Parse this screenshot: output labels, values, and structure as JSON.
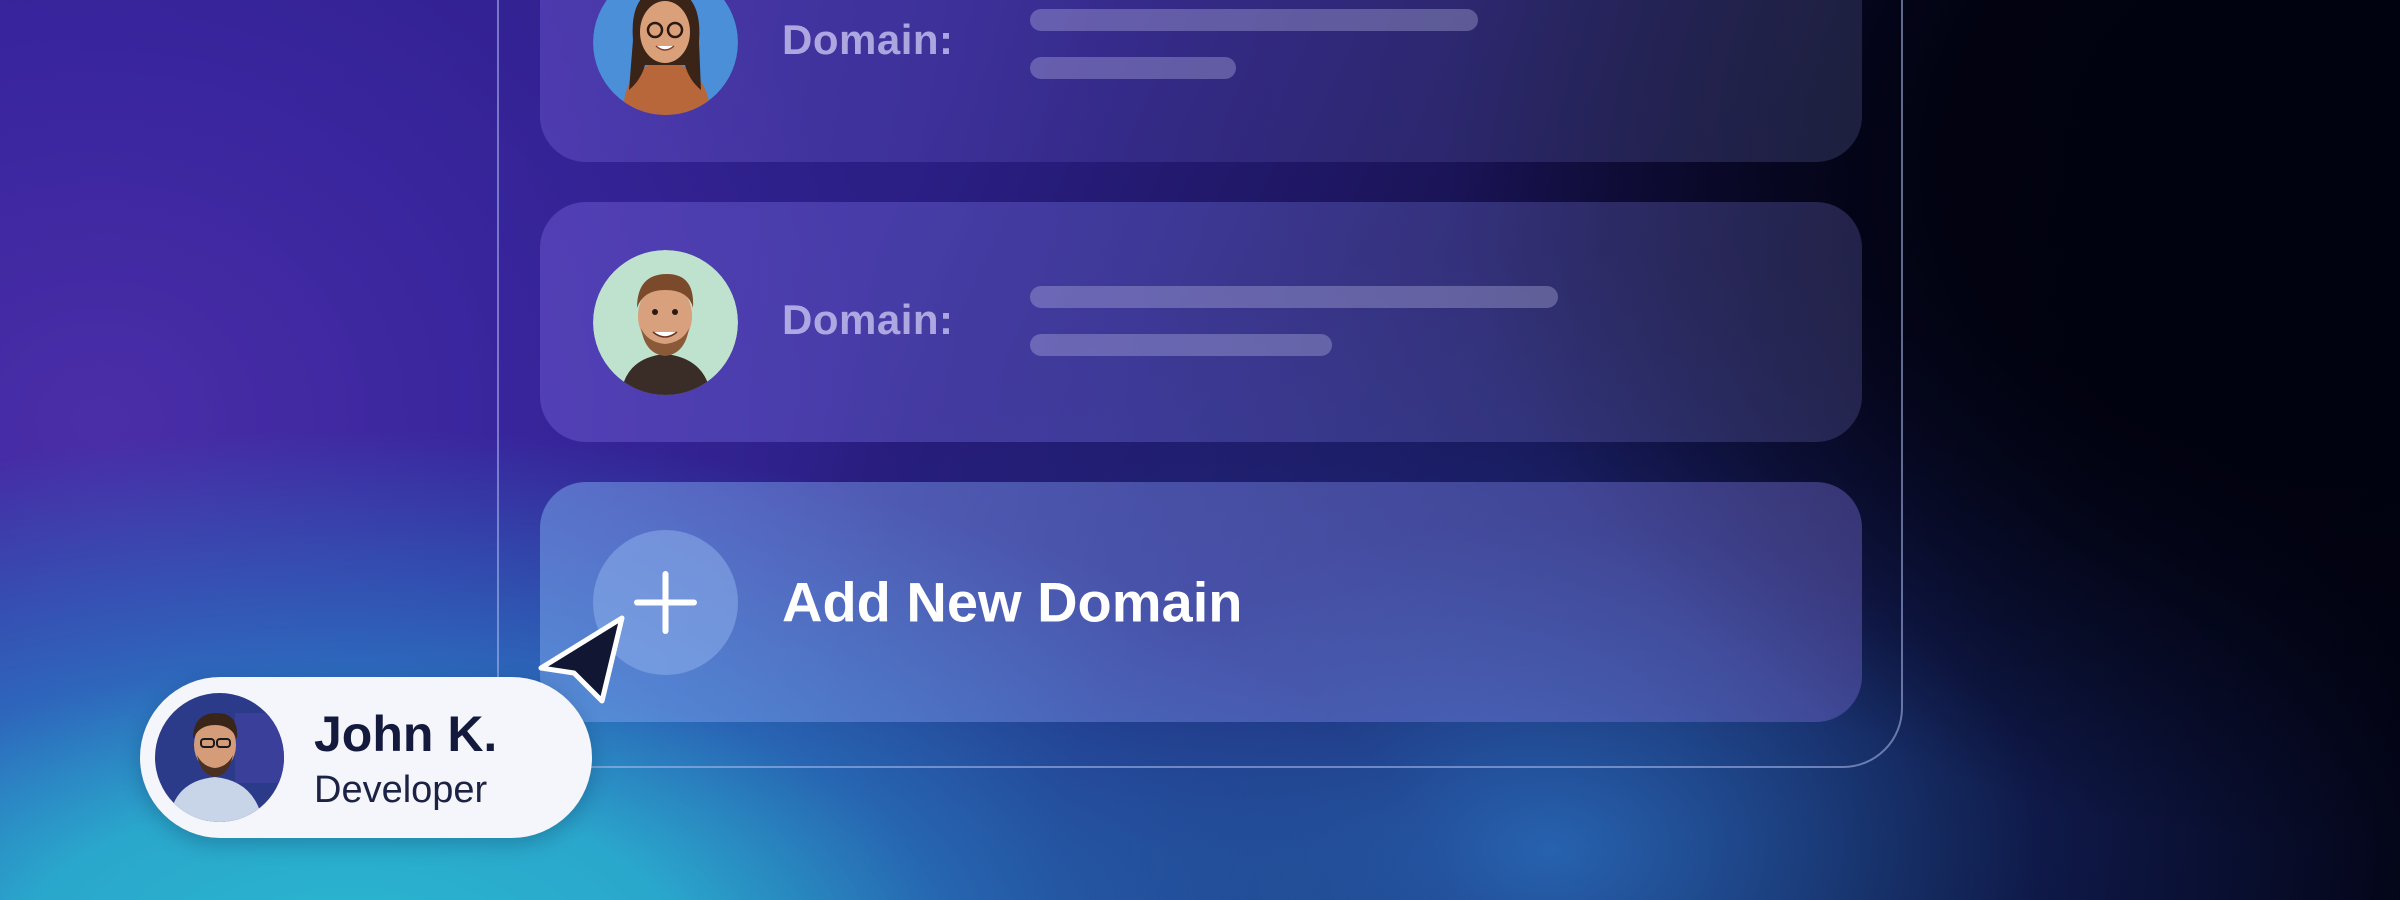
{
  "domains": [
    {
      "label": "Domain:",
      "avatar_icon": "woman-avatar"
    },
    {
      "label": "Domain:",
      "avatar_icon": "man-avatar"
    }
  ],
  "add_domain": {
    "label": "Add New Domain",
    "icon": "plus-icon"
  },
  "user_chip": {
    "name": "John K.",
    "role": "Developer",
    "avatar_icon": "developer-avatar"
  },
  "colors": {
    "accent": "#ffffff",
    "chip_background": "#f5f6fb",
    "chip_text": "#141a3d",
    "cursor": "#111633"
  }
}
